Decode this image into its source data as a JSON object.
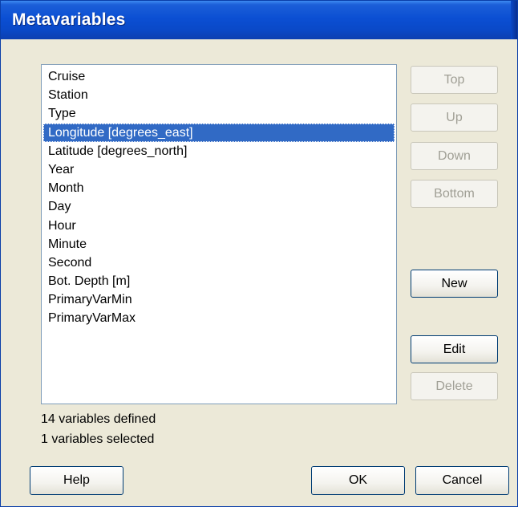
{
  "window": {
    "title": "Metavariables"
  },
  "list": {
    "items": [
      "Cruise",
      "Station",
      "Type",
      "Longitude [degrees_east]",
      "Latitude [degrees_north]",
      "Year",
      "Month",
      "Day",
      "Hour",
      "Minute",
      "Second",
      "Bot. Depth [m]",
      "PrimaryVarMin",
      "PrimaryVarMax"
    ],
    "selected_index": 3
  },
  "side_buttons": {
    "top": "Top",
    "up": "Up",
    "down": "Down",
    "bottom": "Bottom",
    "new": "New",
    "edit": "Edit",
    "delete": "Delete"
  },
  "status": {
    "defined": "14 variables defined",
    "selected": "1 variables selected"
  },
  "footer_buttons": {
    "help": "Help",
    "ok": "OK",
    "cancel": "Cancel"
  },
  "colors": {
    "titlebar": "#0b4fd3",
    "selection": "#316ac5",
    "dialog_bg": "#ece9d8"
  }
}
